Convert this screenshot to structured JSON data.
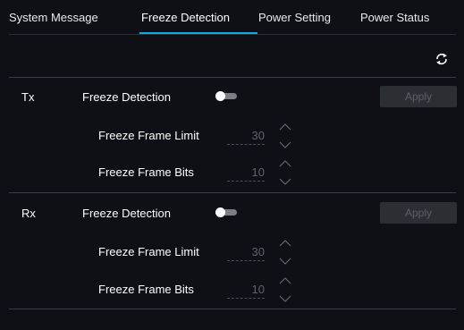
{
  "tabs": [
    {
      "label": "System Message"
    },
    {
      "label": "Freeze Detection"
    },
    {
      "label": "Power Setting"
    },
    {
      "label": "Power Status"
    }
  ],
  "active_tab": "Freeze Detection",
  "colors": {
    "background": "#0e1015",
    "accent": "#19a7e0",
    "disabled_button_bg": "#2b2e33",
    "disabled_text": "#5c6067"
  },
  "toolbar": {
    "refresh_icon": "refresh-icon"
  },
  "tx": {
    "label": "Tx",
    "freeze_detection_label": "Freeze Detection",
    "toggle_on": false,
    "apply_label": "Apply",
    "freeze_frame_limit_label": "Freeze Frame Limit",
    "freeze_frame_limit_value": "30",
    "freeze_frame_bits_label": "Freeze Frame Bits",
    "freeze_frame_bits_value": "10"
  },
  "rx": {
    "label": "Rx",
    "freeze_detection_label": "Freeze Detection",
    "toggle_on": false,
    "apply_label": "Apply",
    "freeze_frame_limit_label": "Freeze Frame Limit",
    "freeze_frame_limit_value": "30",
    "freeze_frame_bits_label": "Freeze Frame Bits",
    "freeze_frame_bits_value": "10"
  }
}
